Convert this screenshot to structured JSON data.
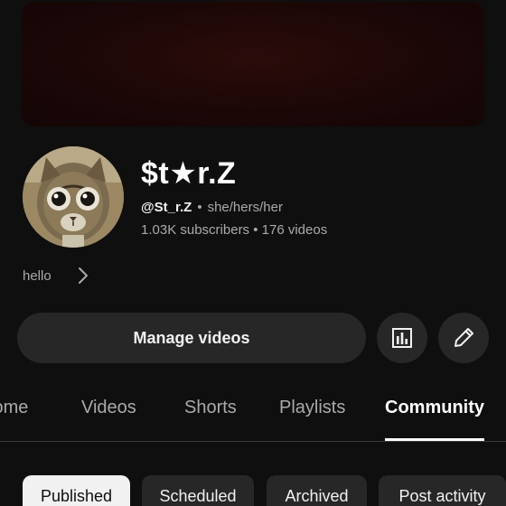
{
  "channel": {
    "name": "$t★r.Z",
    "handle": "@St_r.Z",
    "separator": "•",
    "pronouns": "she/hers/her",
    "stats": "1.03K subscribers • 176 videos",
    "description": "hello"
  },
  "actions": {
    "manage_label": "Manage videos",
    "analytics_icon": "bar-chart-icon",
    "edit_icon": "pencil-icon"
  },
  "tabs": [
    {
      "label": "Home"
    },
    {
      "label": "Videos"
    },
    {
      "label": "Shorts"
    },
    {
      "label": "Playlists"
    },
    {
      "label": "Community"
    }
  ],
  "active_tab": "Community",
  "chips": [
    {
      "label": "Published"
    },
    {
      "label": "Scheduled"
    },
    {
      "label": "Archived"
    },
    {
      "label": "Post activity"
    }
  ],
  "active_chip": "Published",
  "colors": {
    "background": "#0f0f0f",
    "button": "#272727",
    "secondary_text": "#aaaaaa",
    "banner": "#1c0707"
  }
}
